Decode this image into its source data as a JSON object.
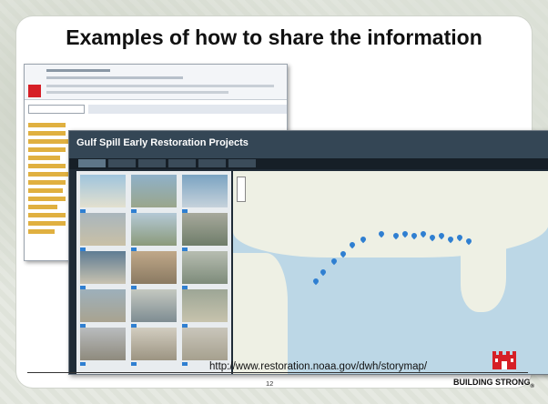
{
  "slide": {
    "title": "Examples of how to share the information",
    "url": "http://www.restoration.noaa.gov/dwh/storymap/",
    "page_number": "12",
    "footer_brand": "BUILDING STRONG",
    "footer_trademark": "®"
  },
  "back_screenshot": {
    "app_title": "",
    "logo": "usace-castle-icon"
  },
  "front_screenshot": {
    "app_title": "Gulf Spill Early Restoration Projects",
    "tabs": [
      "",
      "",
      "",
      "",
      "",
      ""
    ],
    "active_tab": 0
  },
  "colors": {
    "accent": "#d61f26",
    "pin": "#2f7fd1",
    "header": "#344655"
  },
  "icons": [
    "usace-castle-icon",
    "map-pin-icon",
    "zoom-control-icon"
  ]
}
